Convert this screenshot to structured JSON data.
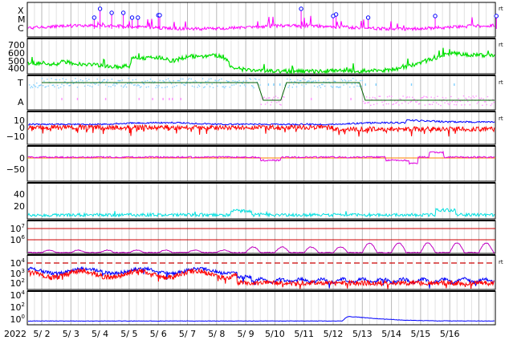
{
  "chart_data": {
    "type": "line",
    "year_label": "2022",
    "x_ticks": [
      "5/ 2",
      "5/ 3",
      "5/ 4",
      "5/ 5",
      "5/ 6",
      "5/ 7",
      "5/ 8",
      "5/ 9",
      "5/10",
      "5/11",
      "5/12",
      "5/13",
      "5/14",
      "5/15",
      "5/16"
    ],
    "corner_mark": "rt",
    "grid": true,
    "panels": [
      {
        "id": "xray-class",
        "y_labels": [
          "X",
          "M",
          "C"
        ],
        "series": [
          {
            "color": "#ff00ff",
            "style": "line"
          },
          {
            "color": "#0000ff",
            "style": "flare-markers"
          }
        ],
        "flare_days": [
          1.8,
          2.0,
          2.4,
          2.8,
          3.1,
          3.3,
          4.0,
          4.05,
          8.9,
          10.0,
          10.1,
          11.2,
          13.5,
          15.6
        ]
      },
      {
        "id": "solar-wind-speed",
        "y_ticks": [
          "700",
          "600",
          "500",
          "400"
        ],
        "ylim": [
          300,
          750
        ],
        "series": [
          {
            "color": "#00e000",
            "style": "line"
          }
        ],
        "points": [
          [
            0.0,
            430
          ],
          [
            0.6,
            410
          ],
          [
            0.7,
            470
          ],
          [
            1.0,
            430
          ],
          [
            2.0,
            400
          ],
          [
            2.5,
            380
          ],
          [
            3.0,
            390
          ],
          [
            3.1,
            505
          ],
          [
            3.5,
            500
          ],
          [
            4.0,
            500
          ],
          [
            4.5,
            460
          ],
          [
            5.0,
            520
          ],
          [
            5.5,
            525
          ],
          [
            6.0,
            530
          ],
          [
            6.3,
            500
          ],
          [
            6.5,
            380
          ],
          [
            7.0,
            340
          ],
          [
            8.0,
            325
          ],
          [
            9.0,
            320
          ],
          [
            10.0,
            330
          ],
          [
            11.0,
            325
          ],
          [
            12.0,
            345
          ],
          [
            12.5,
            380
          ],
          [
            13.0,
            440
          ],
          [
            13.5,
            500
          ],
          [
            14.0,
            570
          ],
          [
            14.5,
            545
          ],
          [
            15.0,
            540
          ],
          [
            15.5,
            525
          ],
          [
            15.9,
            525
          ]
        ]
      },
      {
        "id": "imf-sector",
        "y_labels": [
          "T",
          "A"
        ],
        "series": [
          {
            "color": "#80d0ff",
            "style": "scatter"
          },
          {
            "color": "#ff90ff",
            "style": "scatter"
          },
          {
            "color": "#006000",
            "style": "step"
          }
        ],
        "step": [
          [
            0.0,
            1
          ],
          [
            7.4,
            1
          ],
          [
            7.6,
            0
          ],
          [
            8.2,
            0
          ],
          [
            8.4,
            1
          ],
          [
            10.9,
            1
          ],
          [
            11.1,
            0
          ],
          [
            15.9,
            0
          ]
        ]
      },
      {
        "id": "imf-bz",
        "y_ticks": [
          "10",
          "0",
          "−10"
        ],
        "ylim": [
          -15,
          15
        ],
        "series": [
          {
            "color": "#0000ff",
            "style": "line"
          },
          {
            "color": "#ff0000",
            "style": "line"
          }
        ]
      },
      {
        "id": "dst",
        "y_ticks": [
          "0",
          "−50"
        ],
        "ylim": [
          -70,
          25
        ],
        "series": [
          {
            "color": "#e000e0",
            "style": "line"
          },
          {
            "color": "#ff8000",
            "style": "hline"
          }
        ]
      },
      {
        "id": "ap-index",
        "y_ticks": [
          "40",
          "20"
        ],
        "ylim": [
          0,
          55
        ],
        "series": [
          {
            "color": "#00e0e0",
            "style": "line"
          }
        ]
      },
      {
        "id": "electron-flux",
        "y_ticks": [
          "10^7",
          "10^6"
        ],
        "series": [
          {
            "color": "#cc0000",
            "style": "hline"
          },
          {
            "color": "#c000c0",
            "style": "line"
          }
        ]
      },
      {
        "id": "proton-flux-high",
        "y_ticks": [
          "10^4",
          "10^3",
          "10^2"
        ],
        "series": [
          {
            "color": "#0000ff",
            "style": "line"
          },
          {
            "color": "#ff0000",
            "style": "line"
          },
          {
            "color": "#cc0000",
            "style": "dashed-hline"
          }
        ]
      },
      {
        "id": "proton-flux-low",
        "y_ticks": [
          "10^4",
          "10^2",
          "10^0"
        ],
        "series": [
          {
            "color": "#0000ff",
            "style": "line"
          }
        ],
        "points": [
          [
            0.0,
            0.05
          ],
          [
            10.3,
            0.05
          ],
          [
            10.5,
            0.45
          ],
          [
            10.8,
            0.4
          ],
          [
            11.5,
            0.25
          ],
          [
            12.5,
            0.12
          ],
          [
            13.5,
            0.06
          ],
          [
            15.9,
            0.05
          ]
        ]
      }
    ]
  }
}
